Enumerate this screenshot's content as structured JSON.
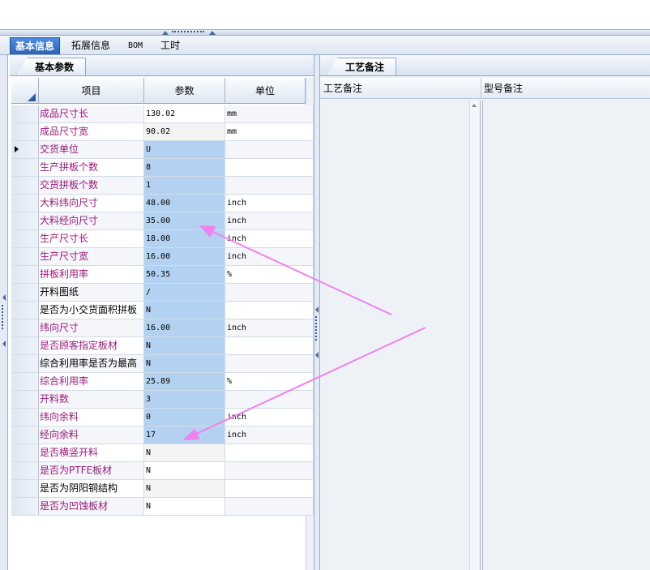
{
  "tabs": [
    "基本信息",
    "拓展信息",
    "BOM",
    "工时"
  ],
  "left_panel": {
    "tab": "基本参数",
    "columns": {
      "item": "项目",
      "param": "参数",
      "unit": "单位"
    },
    "rows": [
      {
        "name": "成品尺寸长",
        "value": "130.02",
        "unit": "mm",
        "name_color": "#9a1a7a",
        "val_bg": "#ffffff"
      },
      {
        "name": "成品尺寸宽",
        "value": "90.02",
        "unit": "mm",
        "name_color": "#9a1a7a",
        "val_bg": "#f4f4f4"
      },
      {
        "name": "交货单位",
        "value": "U",
        "unit": "",
        "name_color": "#9a1a7a",
        "val_bg": "#b3d2f2",
        "current": true
      },
      {
        "name": "生产拼板个数",
        "value": "8",
        "unit": "",
        "name_color": "#9a1a7a",
        "val_bg": "#b3d2f2"
      },
      {
        "name": "交货拼板个数",
        "value": "1",
        "unit": "",
        "name_color": "#9a1a7a",
        "val_bg": "#b3d2f2"
      },
      {
        "name": "大料纬向尺寸",
        "value": "48.00",
        "unit": "inch",
        "name_color": "#9a1a7a",
        "val_bg": "#b3d2f2"
      },
      {
        "name": "大料经向尺寸",
        "value": "35.00",
        "unit": "inch",
        "name_color": "#9a1a7a",
        "val_bg": "#b3d2f2"
      },
      {
        "name": "生产尺寸长",
        "value": "18.00",
        "unit": "inch",
        "name_color": "#9a1a7a",
        "val_bg": "#b3d2f2"
      },
      {
        "name": "生产尺寸宽",
        "value": "16.00",
        "unit": "inch",
        "name_color": "#9a1a7a",
        "val_bg": "#b3d2f2"
      },
      {
        "name": "拼板利用率",
        "value": "50.35",
        "unit": "%",
        "name_color": "#9a1a7a",
        "val_bg": "#b3d2f2"
      },
      {
        "name": "开料图纸",
        "value": "/",
        "unit": "",
        "name_color": "#000000",
        "val_bg": "#b3d2f2"
      },
      {
        "name": "是否为小交货面积拼板",
        "value": "N",
        "unit": "",
        "name_color": "#000000",
        "val_bg": "#b3d2f2"
      },
      {
        "name": "纬向尺寸",
        "value": "16.00",
        "unit": "inch",
        "name_color": "#9a1a7a",
        "val_bg": "#b3d2f2"
      },
      {
        "name": "是否顾客指定板材",
        "value": "N",
        "unit": "",
        "name_color": "#9a1a7a",
        "val_bg": "#b3d2f2"
      },
      {
        "name": "综合利用率是否为最高",
        "value": "N",
        "unit": "",
        "name_color": "#000000",
        "val_bg": "#b3d2f2"
      },
      {
        "name": "综合利用率",
        "value": "25.89",
        "unit": "%",
        "name_color": "#9a1a7a",
        "val_bg": "#b3d2f2"
      },
      {
        "name": "开料数",
        "value": "3",
        "unit": "",
        "name_color": "#9a1a7a",
        "val_bg": "#b3d2f2"
      },
      {
        "name": "纬向余料",
        "value": "0",
        "unit": "inch",
        "name_color": "#9a1a7a",
        "val_bg": "#b3d2f2"
      },
      {
        "name": "经向余料",
        "value": "17",
        "unit": "inch",
        "name_color": "#9a1a7a",
        "val_bg": "#b3d2f2"
      },
      {
        "name": "是否横竖开料",
        "value": "N",
        "unit": "",
        "name_color": "#9a1a7a",
        "val_bg": "#f4f4f4"
      },
      {
        "name": "是否为PTFE板材",
        "value": "N",
        "unit": "",
        "name_color": "#9a1a7a",
        "val_bg": "#ffffff"
      },
      {
        "name": "是否为阴阳铜结构",
        "value": "N",
        "unit": "",
        "name_color": "#000000",
        "val_bg": "#f4f4f4"
      },
      {
        "name": "是否为凹蚀板材",
        "value": "N",
        "unit": "",
        "name_color": "#9a1a7a",
        "val_bg": "#ffffff"
      }
    ]
  },
  "right_panel": {
    "tab": "工艺备注",
    "columns": [
      "工艺备注",
      "型号备注"
    ]
  },
  "colors": {
    "annotation_arrow": "#ee82ee",
    "selection": "#b3d2f2",
    "label_purple": "#9a1a7a"
  }
}
